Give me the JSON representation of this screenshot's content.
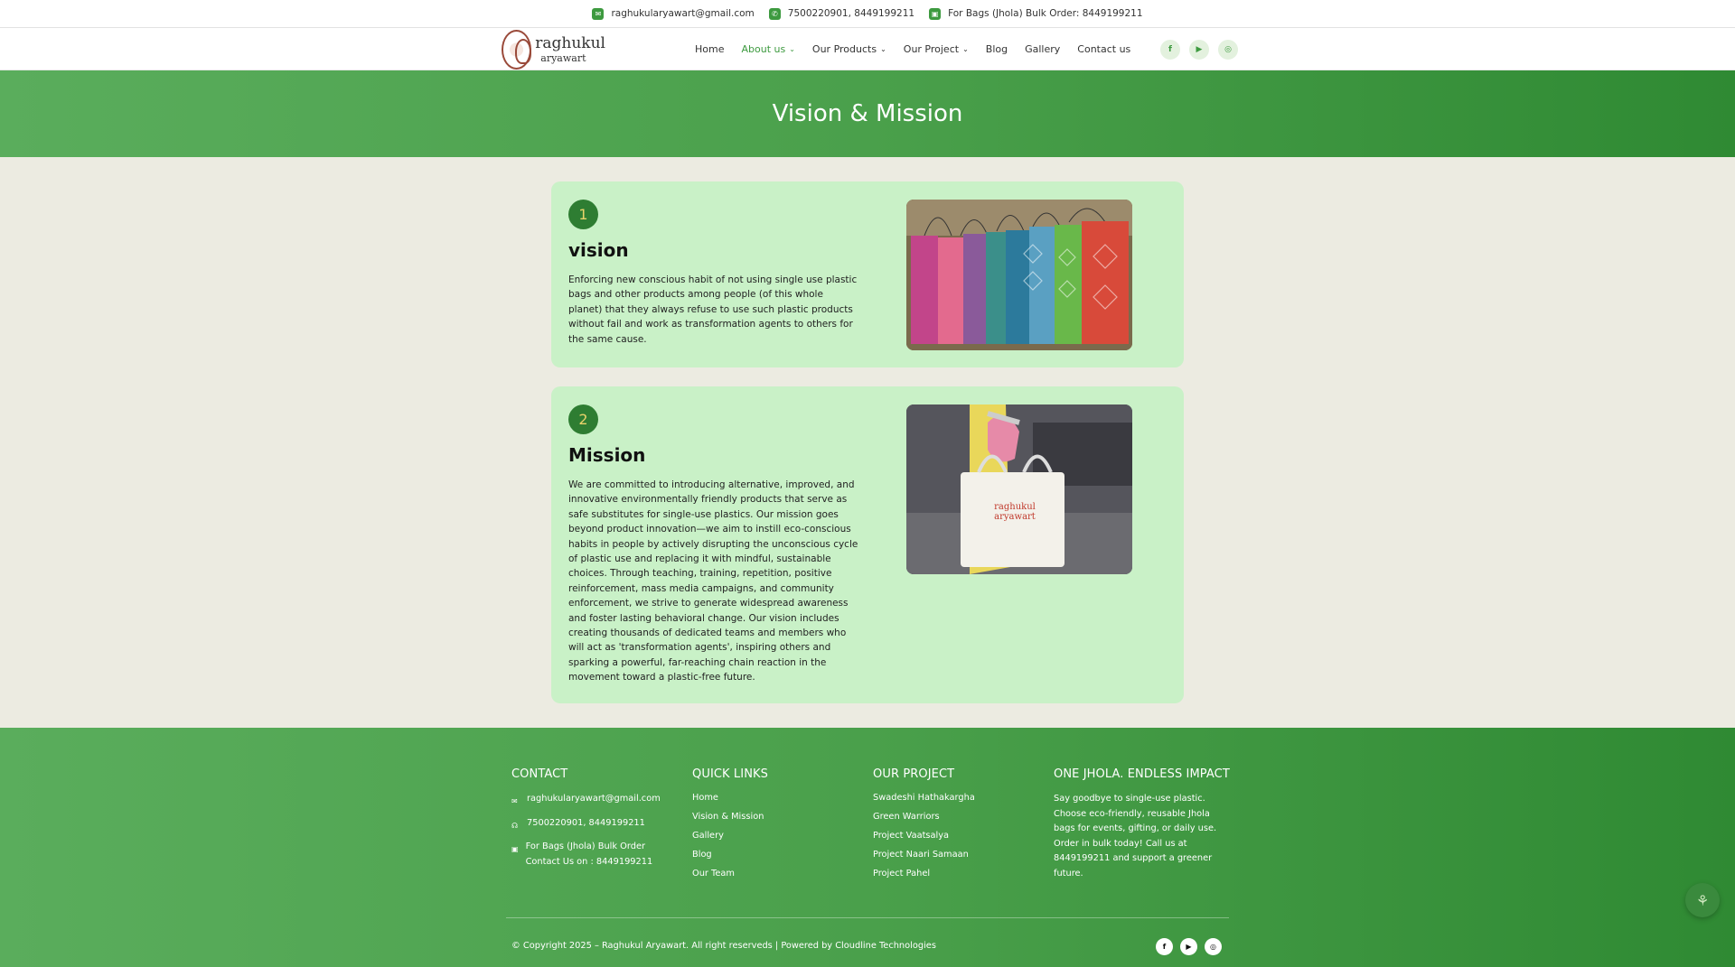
{
  "topbar": {
    "email": "raghukularyawart@gmail.com",
    "phone": "7500220901, 8449199211",
    "bulk": "For Bags (Jhola) Bulk Order: 8449199211"
  },
  "brand": {
    "line1": "raghukul",
    "line2": "aryawart"
  },
  "nav": {
    "items": [
      {
        "label": "Home"
      },
      {
        "label": "About us"
      },
      {
        "label": "Our Products"
      },
      {
        "label": "Our Project"
      },
      {
        "label": "Blog"
      },
      {
        "label": "Gallery"
      },
      {
        "label": "Contact us"
      }
    ],
    "active": "About us",
    "social_icons": [
      "facebook-icon",
      "youtube-icon",
      "instagram-icon"
    ]
  },
  "hero": {
    "title": "Vision & Mission"
  },
  "cards": [
    {
      "number": "1",
      "title": "vision",
      "text": "Enforcing new conscious habit of not using single use plastic bags and other products among people (of this whole planet) that they always refuse to use such plastic products without fail and work as transformation agents to others for the same cause."
    },
    {
      "number": "2",
      "title": "Mission",
      "text": "We are committed to introducing alternative, improved, and innovative environmentally friendly products that serve as safe substitutes for single-use plastics. Our mission goes beyond product innovation—we aim to instill eco-conscious habits in people by actively disrupting the unconscious cycle of plastic use and replacing it with mindful, sustainable choices. Through teaching, training, repetition, positive reinforcement, mass media campaigns, and community enforcement, we strive to generate widespread awareness and foster lasting behavioral change. Our vision includes creating thousands of dedicated teams and members who will act as 'transformation agents', inspiring others and sparking a powerful, far-reaching chain reaction in the movement toward a plastic-free future.",
      "photo_text": "raghukul aryawart"
    }
  ],
  "footer": {
    "contact": {
      "heading": "CONTACT",
      "email": "raghukularyawart@gmail.com",
      "phone": "7500220901, 8449199211",
      "bulk": "For Bags (Jhola) Bulk Order Contact Us on : 8449199211"
    },
    "quick_links": {
      "heading": "QUICK LINKS",
      "items": [
        "Home",
        "Vision & Mission",
        "Gallery",
        "Blog",
        "Our Team"
      ]
    },
    "project": {
      "heading": "OUR PROJECT",
      "items": [
        "Swadeshi Hathakargha",
        "Green Warriors",
        "Project Vaatsalya",
        "Project Naari Samaan",
        "Project Pahel"
      ]
    },
    "impact": {
      "heading": "ONE JHOLA. ENDLESS IMPACT",
      "text": "Say goodbye to single-use plastic. Choose eco-friendly, reusable Jhola bags for events, gifting, or daily use. Order in bulk today! Call us at 8449199211 and support a greener future."
    },
    "copyright": "© Copyright 2025 – Raghukul Aryawart. All right reserveds | Powered by Cloudline Technologies",
    "social_icons": [
      "facebook-icon",
      "youtube-icon",
      "instagram-icon"
    ]
  },
  "colors": {
    "brand_green": "#3d9a3f",
    "card_bg": "#c9f1c7",
    "number_bg": "#2e7d32"
  }
}
